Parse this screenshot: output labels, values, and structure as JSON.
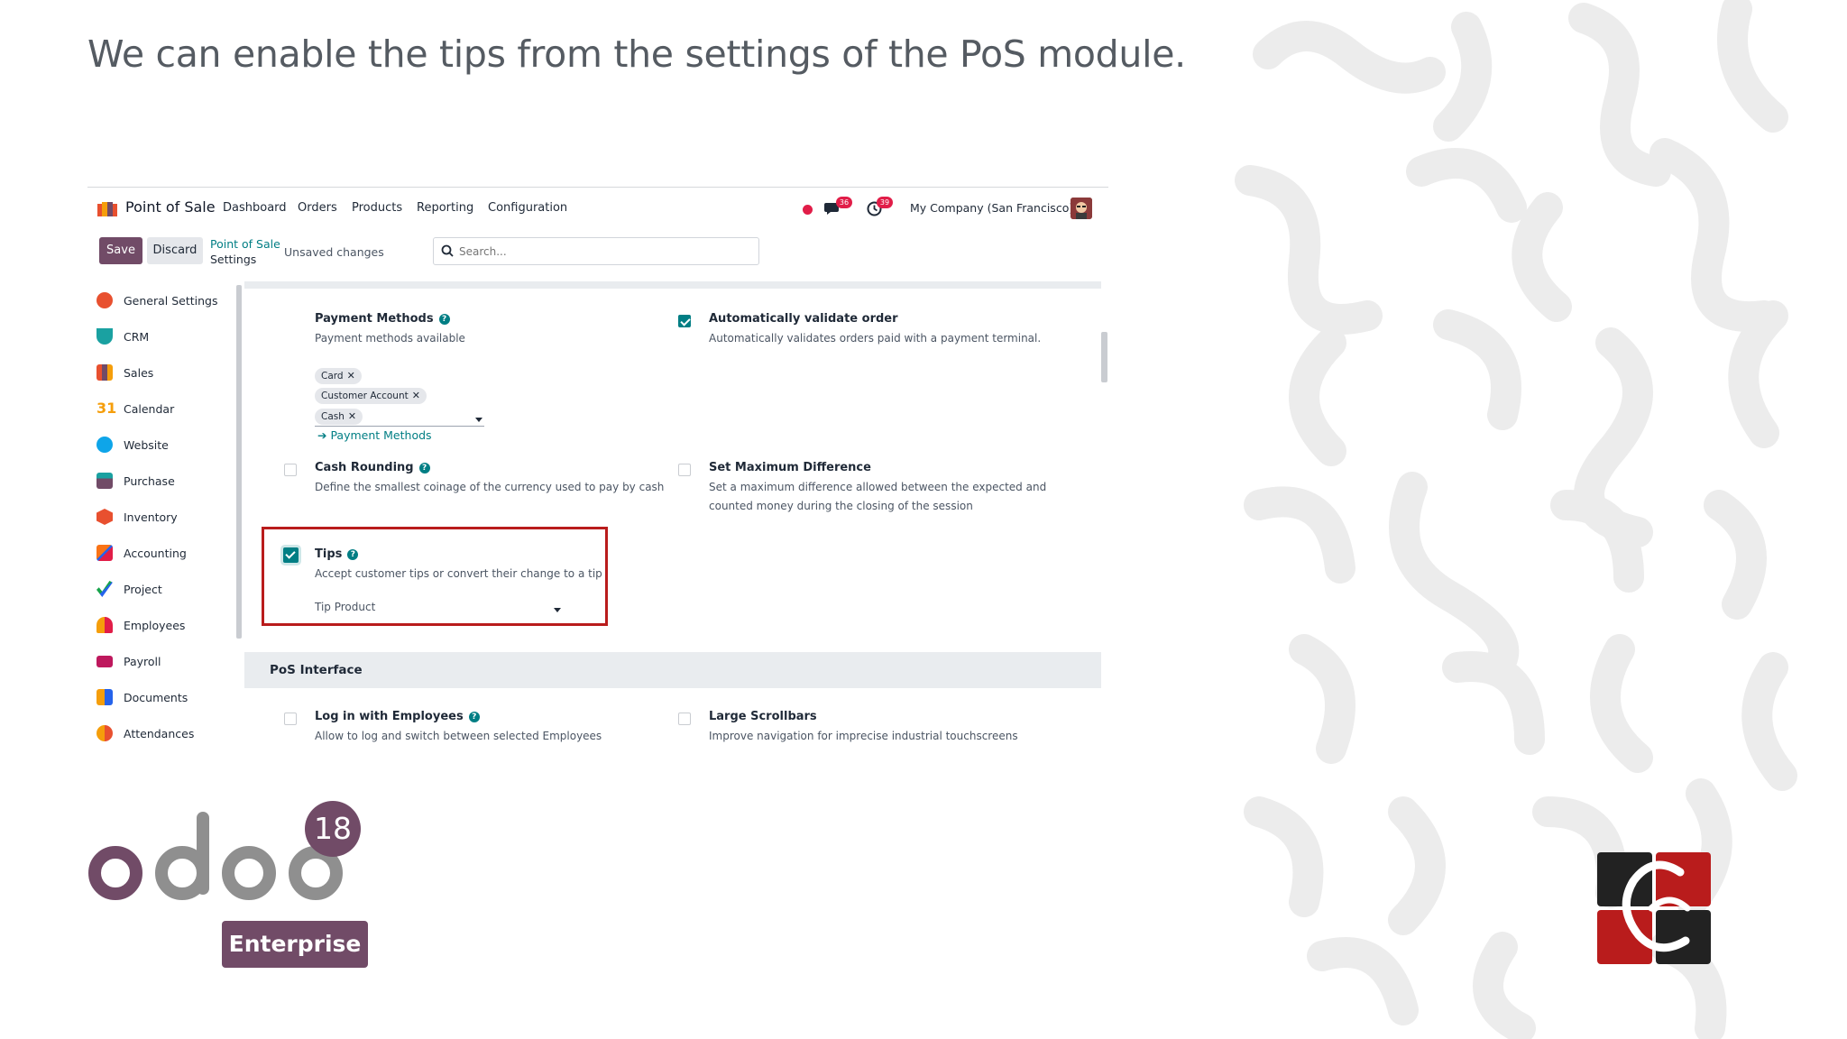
{
  "slide": {
    "heading": "We can enable the tips from the settings of the PoS module."
  },
  "navbar": {
    "app_name": "Point of Sale",
    "menus": [
      "Dashboard",
      "Orders",
      "Products",
      "Reporting",
      "Configuration"
    ],
    "messages_count": "36",
    "activities_count": "39",
    "company": "My Company (San Francisco)"
  },
  "control_panel": {
    "save_label": "Save",
    "discard_label": "Discard",
    "breadcrumb_parent": "Point of Sale",
    "breadcrumb_current": "Settings",
    "status": "Unsaved changes",
    "search_placeholder": "Search..."
  },
  "sidebar": {
    "items": [
      {
        "label": "General Settings",
        "icon": "general-settings-icon",
        "color": "#e8502f"
      },
      {
        "label": "CRM",
        "icon": "crm-icon",
        "color": "#1aa1a1"
      },
      {
        "label": "Sales",
        "icon": "sales-icon",
        "color": "#e8502f"
      },
      {
        "label": "Calendar",
        "icon": "calendar-icon",
        "color": "#f59e0b"
      },
      {
        "label": "Website",
        "icon": "website-icon",
        "color": "#0ea5e9"
      },
      {
        "label": "Purchase",
        "icon": "purchase-icon",
        "color": "#714b67"
      },
      {
        "label": "Inventory",
        "icon": "inventory-icon",
        "color": "#e8502f"
      },
      {
        "label": "Accounting",
        "icon": "accounting-icon",
        "color": "#f97316"
      },
      {
        "label": "Project",
        "icon": "project-icon",
        "color": "#16a34a"
      },
      {
        "label": "Employees",
        "icon": "employees-icon",
        "color": "#f59e0b"
      },
      {
        "label": "Payroll",
        "icon": "payroll-icon",
        "color": "#be185d"
      },
      {
        "label": "Documents",
        "icon": "documents-icon",
        "color": "#f59e0b"
      },
      {
        "label": "Attendances",
        "icon": "attendances-icon",
        "color": "#f59e0b"
      }
    ]
  },
  "settings": {
    "payment_methods": {
      "title": "Payment Methods",
      "desc": "Payment methods available",
      "tags": [
        "Card",
        "Customer Account",
        "Cash"
      ],
      "link": "Payment Methods"
    },
    "auto_validate": {
      "title": "Automatically validate order",
      "desc": "Automatically validates orders paid with a payment terminal.",
      "checked": true
    },
    "cash_rounding": {
      "title": "Cash Rounding",
      "desc": "Define the smallest coinage of the currency used to pay by cash",
      "checked": false
    },
    "max_difference": {
      "title": "Set Maximum Difference",
      "desc1": "Set a maximum difference allowed between the expected and",
      "desc2": "counted money during the closing of the session",
      "checked": false
    },
    "tips": {
      "title": "Tips",
      "desc": "Accept customer tips or convert their change to a tip",
      "product_label": "Tip Product",
      "checked": true
    },
    "section_pos_interface": "PoS Interface",
    "login_employees": {
      "title": "Log in with Employees",
      "desc": "Allow to log and switch between selected Employees",
      "checked": false
    },
    "large_scrollbars": {
      "title": "Large Scrollbars",
      "desc": "Improve navigation for imprecise industrial touchscreens",
      "checked": false
    }
  },
  "branding": {
    "version": "18",
    "edition": "Enterprise",
    "accent": "#714b67",
    "highlight": "#b91c1c"
  }
}
